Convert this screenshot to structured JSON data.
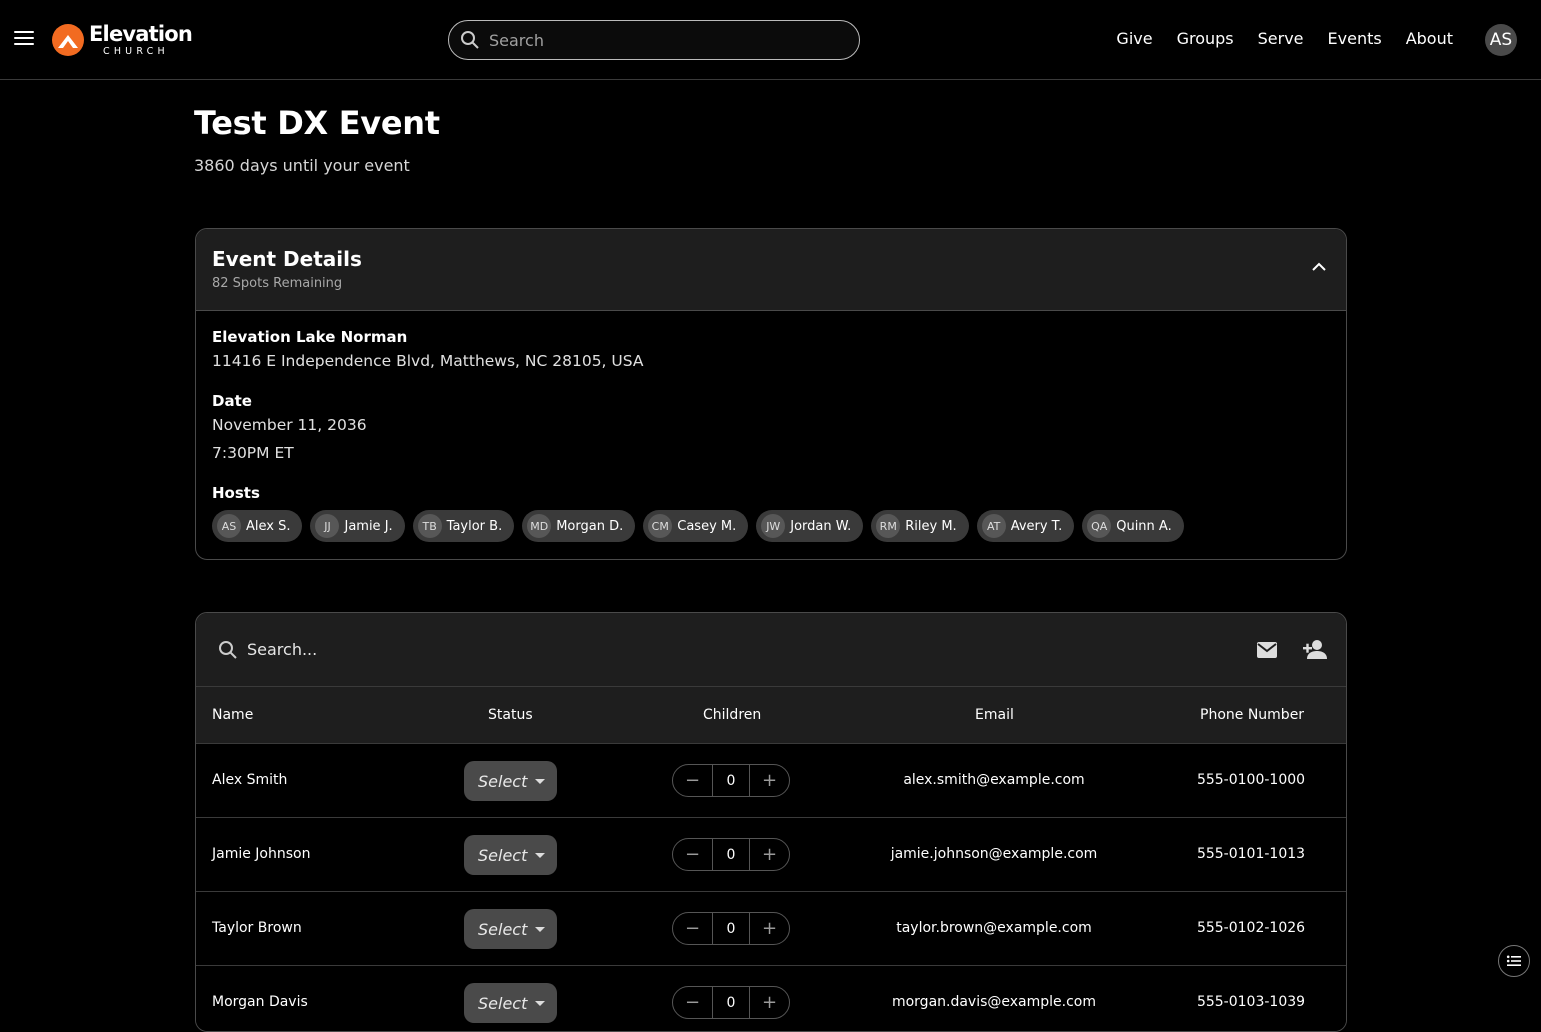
{
  "header": {
    "brand_word": "Elevation",
    "brand_sub": "CHURCH",
    "search_placeholder": "Search",
    "nav": [
      "Give",
      "Groups",
      "Serve",
      "Events",
      "About"
    ],
    "avatar_initials": "AS"
  },
  "event": {
    "title": "Test DX Event",
    "countdown": "3860 days until your event"
  },
  "details": {
    "title": "Event Details",
    "spots": "82 Spots Remaining",
    "location_label": "Elevation Lake Norman",
    "location_address": "11416 E Independence Blvd, Matthews, NC 28105, USA",
    "date_label": "Date",
    "date_value": "November 11, 2036",
    "time_value": "7:30PM ET",
    "hosts_label": "Hosts",
    "hosts": [
      {
        "initials": "AS",
        "name": "Alex S."
      },
      {
        "initials": "JJ",
        "name": "Jamie J."
      },
      {
        "initials": "TB",
        "name": "Taylor B."
      },
      {
        "initials": "MD",
        "name": "Morgan D."
      },
      {
        "initials": "CM",
        "name": "Casey M."
      },
      {
        "initials": "JW",
        "name": "Jordan W."
      },
      {
        "initials": "RM",
        "name": "Riley M."
      },
      {
        "initials": "AT",
        "name": "Avery T."
      },
      {
        "initials": "QA",
        "name": "Quinn A."
      }
    ]
  },
  "attendees": {
    "search_placeholder": "Search...",
    "columns": [
      "Name",
      "Status",
      "Children",
      "Email",
      "Phone Number"
    ],
    "rows": [
      {
        "name": "Alex Smith",
        "status": "Select",
        "children": "0",
        "email": "alex.smith@example.com",
        "phone": "555-0100-1000"
      },
      {
        "name": "Jamie Johnson",
        "status": "Select",
        "children": "0",
        "email": "jamie.johnson@example.com",
        "phone": "555-0101-1013"
      },
      {
        "name": "Taylor Brown",
        "status": "Select",
        "children": "0",
        "email": "taylor.brown@example.com",
        "phone": "555-0102-1026"
      },
      {
        "name": "Morgan Davis",
        "status": "Select",
        "children": "0",
        "email": "morgan.davis@example.com",
        "phone": "555-0103-1039"
      }
    ]
  },
  "colors": {
    "accent": "#f26b21",
    "surface": "#1e1e1e",
    "border": "#4a4a4a"
  }
}
